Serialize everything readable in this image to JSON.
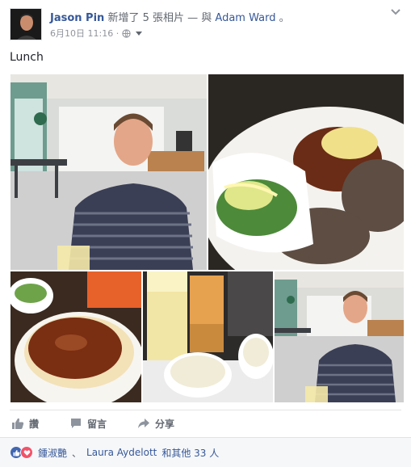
{
  "post": {
    "author": "Jason Pin",
    "action": "新增了 5 張相片 — 與",
    "tagged": "Adam Ward",
    "trailing": "。",
    "timestamp": "6月10日 11:16 ·",
    "audience_icon": "globe-icon",
    "text": "Lunch",
    "photos": [
      {
        "subject": "man-seated-cafe"
      },
      {
        "subject": "hamburg-steak-salad-plate"
      },
      {
        "subject": "curry-rice-bowl"
      },
      {
        "subject": "iced-drinks-soup"
      },
      {
        "subject": "man-seated-cafe-wide"
      }
    ]
  },
  "actions": {
    "like": "讚",
    "comment": "留言",
    "share": "分享"
  },
  "reactions": {
    "icons": [
      "like-icon",
      "love-icon"
    ],
    "first_reactor": "鍾淑艷",
    "separator": "、",
    "second_reactor": "Laura Aydelott",
    "others": "和其他 33 人"
  },
  "colors": {
    "link": "#365899",
    "secondary_text": "#616770",
    "like_blue": "#4267b2",
    "love_red": "#f25268",
    "bar_bg": "#f6f7f9"
  }
}
